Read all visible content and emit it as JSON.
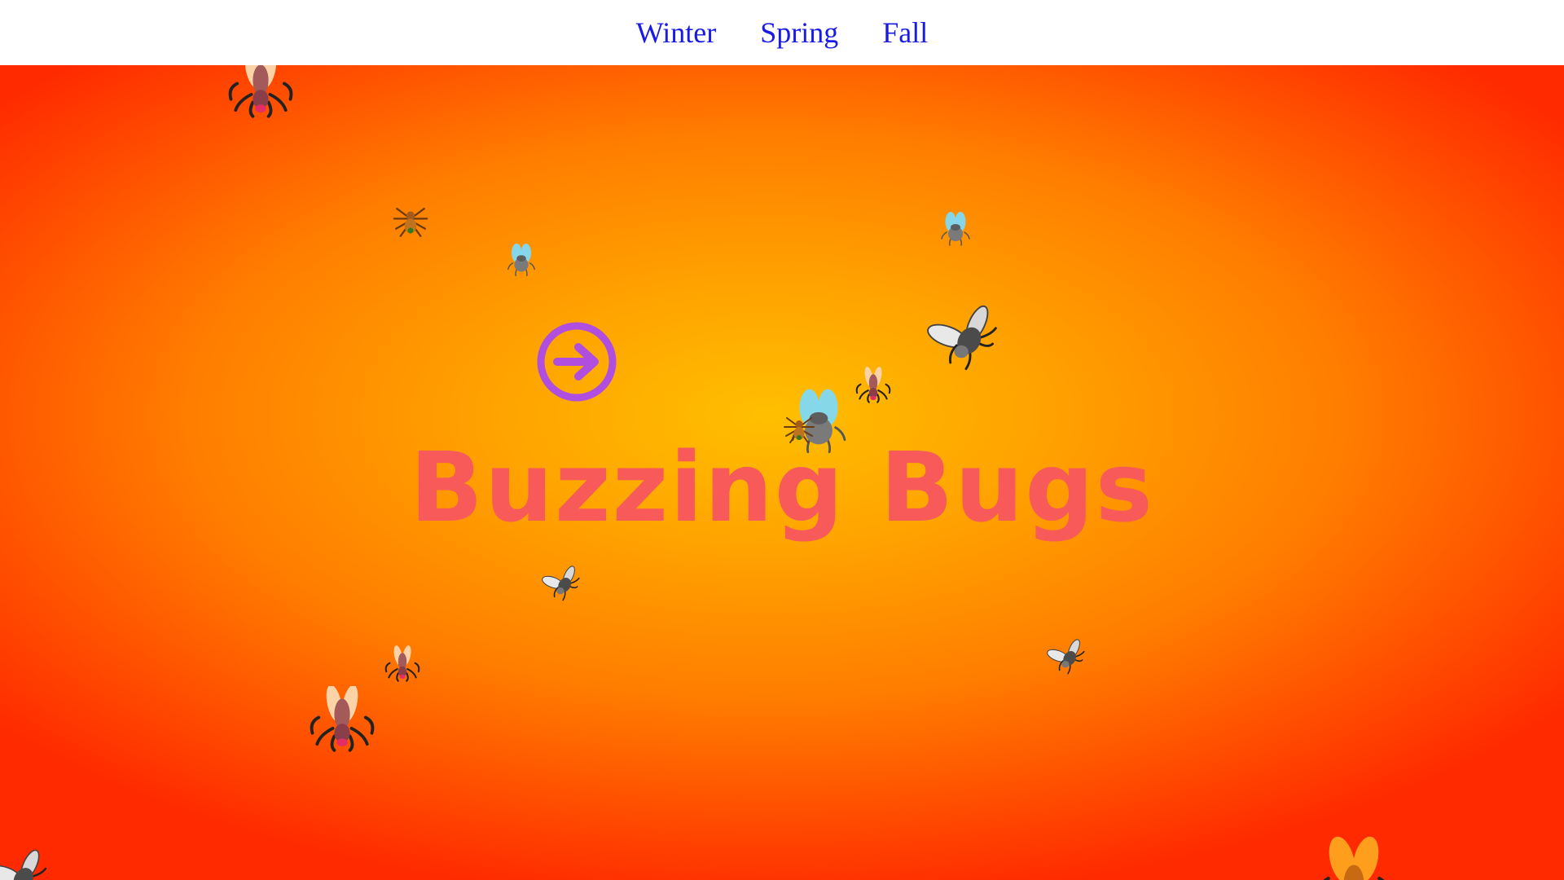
{
  "nav": {
    "links": [
      "Winter",
      "Spring",
      "Fall"
    ]
  },
  "hero": {
    "title": "Buzzing Bugs",
    "play_icon": "arrow-right-circle-icon"
  },
  "colors": {
    "nav_link": "#1a1ae6",
    "title": "#f85a5a",
    "play_icon": "#b04ee0",
    "bg_center": "#ffbf00",
    "bg_edge": "#ff2a00"
  },
  "bugs": [
    "mosquito-icon",
    "spider-icon",
    "fly-icon",
    "fly-icon",
    "housefly-icon",
    "mosquito-icon",
    "fly-icon",
    "spider-icon",
    "housefly-icon",
    "mosquito-icon",
    "housefly-icon",
    "mosquito-icon",
    "housefly-icon",
    "mosquito-icon"
  ]
}
